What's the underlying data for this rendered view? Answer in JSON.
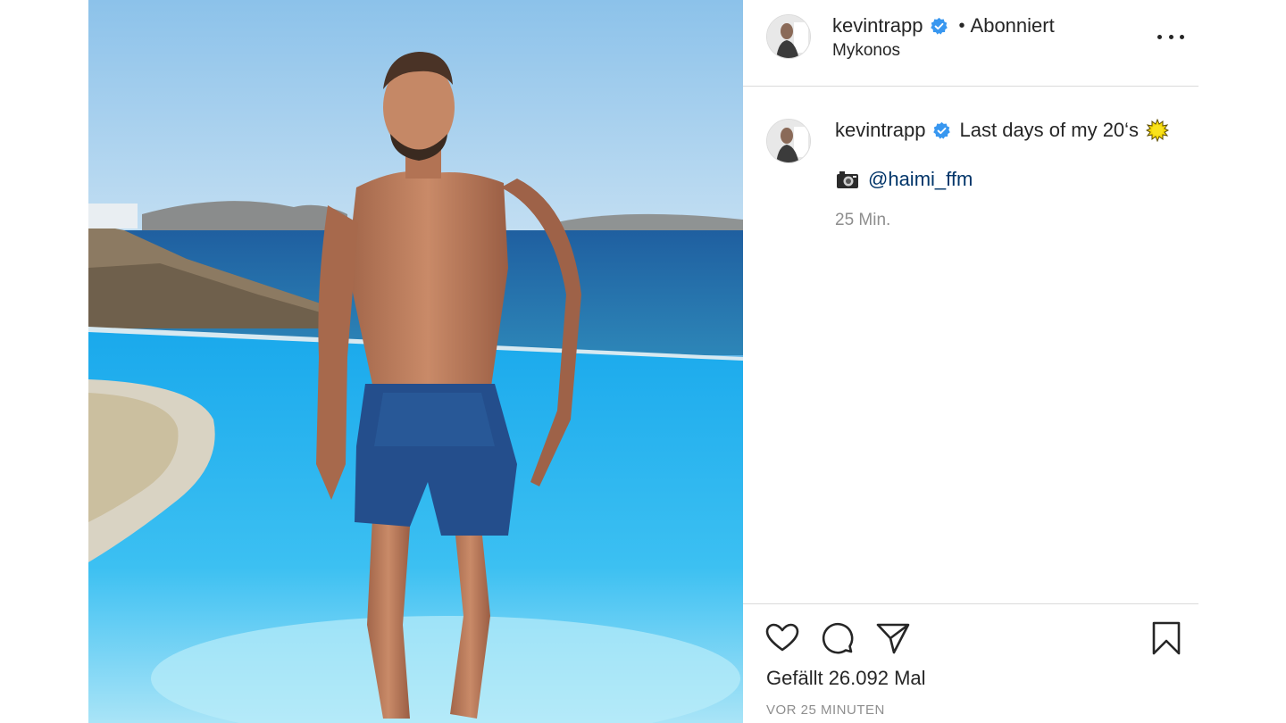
{
  "post": {
    "username": "kevintrapp",
    "follow_status": "Abonniert",
    "separator": "•",
    "location": "Mykonos",
    "verified_icon": "verified-badge-icon",
    "more_icon": "more-options-icon"
  },
  "caption": {
    "username": "kevintrapp",
    "text": "Last days of my 20‘s",
    "emoji": "sun-emoji-icon",
    "credit_icon": "camera-emoji-icon",
    "mention": "@haimi_ffm",
    "time": "25 Min."
  },
  "actions": {
    "like_icon": "heart-icon",
    "comment_icon": "comment-bubble-icon",
    "share_icon": "paper-plane-icon",
    "save_icon": "bookmark-icon",
    "likes_text": "Gefällt 26.092 Mal",
    "posted_time": "VOR 25 MINUTEN"
  },
  "colors": {
    "verified": "#3897f0",
    "link": "#003569",
    "muted": "#8e8e8e",
    "border": "#dbdbdb"
  }
}
